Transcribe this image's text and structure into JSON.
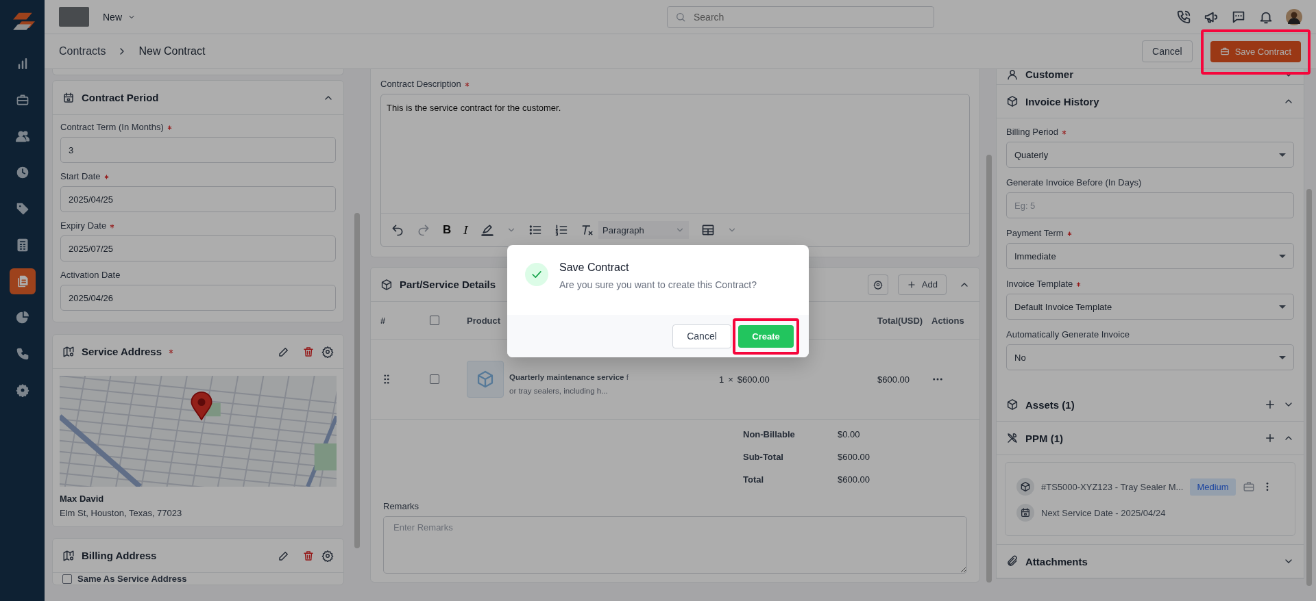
{
  "sidebar": {
    "items": [
      {
        "selected": false
      },
      {
        "selected": false
      },
      {
        "selected": false
      },
      {
        "selected": false
      },
      {
        "selected": false
      },
      {
        "selected": false
      },
      {
        "selected": true
      },
      {
        "selected": false
      },
      {
        "selected": false
      },
      {
        "selected": false
      }
    ]
  },
  "topbar": {
    "workspace_menu": "New",
    "search": {
      "placeholder": "Search"
    }
  },
  "header": {
    "breadcrumb": [
      "Contracts",
      "New Contract"
    ],
    "cancel_button": "Cancel",
    "save_button": {
      "label": "Save Contract",
      "highlighted": true
    }
  },
  "contract_period": {
    "title": "Contract Period",
    "expanded": true,
    "fields": [
      {
        "label": "Contract Term (In Months)",
        "required": true,
        "value": "3"
      },
      {
        "label": "Start Date",
        "required": true,
        "value": "2025/04/25"
      },
      {
        "label": "Expiry Date",
        "required": true,
        "value": "2025/07/25"
      },
      {
        "label": "Activation Date",
        "required": false,
        "value": "2025/04/26"
      }
    ]
  },
  "service_address": {
    "title": "Service Address",
    "required": true,
    "contact_name": "Max David",
    "address": "Elm St, Houston, Texas, 77023"
  },
  "billing_address": {
    "title": "Billing Address",
    "same_as_service": {
      "label": "Same As Service Address",
      "checked": false
    }
  },
  "description": {
    "label": "Contract Description",
    "required": true,
    "value": "This is the service contract for the customer.",
    "bold_glyph": "B",
    "italic_glyph": "I",
    "block_format": "Paragraph"
  },
  "parts": {
    "title": "Part/Service Details",
    "add_label": "Add",
    "expanded": true,
    "columns": [
      "#",
      "Product",
      "Total(USD)",
      "Actions"
    ],
    "select_all": false,
    "rows": [
      {
        "checked": false,
        "description": "**Quarterly maintenance service** for tray sealers, including h...",
        "quantity": "1",
        "multiply_sign": "×",
        "price": "$600.00",
        "total": "$600.00"
      }
    ],
    "summary": [
      {
        "label": "Non-Billable",
        "value": "$0.00"
      },
      {
        "label": "Sub-Total",
        "value": "$600.00"
      },
      {
        "label": "Total",
        "value": "$600.00"
      }
    ],
    "remarks": {
      "label": "Remarks",
      "placeholder": "Enter Remarks"
    }
  },
  "customer": {
    "title": "Customer",
    "expanded": false
  },
  "invoice_history": {
    "title": "Invoice History",
    "expanded": true,
    "fields": [
      {
        "kind": "select",
        "label": "Billing Period",
        "required": true,
        "value": "Quaterly"
      },
      {
        "kind": "input",
        "label": "Generate Invoice Before (In Days)",
        "required": false,
        "placeholder": "Eg: 5"
      },
      {
        "kind": "select",
        "label": "Payment Term",
        "required": true,
        "value": "Immediate"
      },
      {
        "kind": "select",
        "label": "Invoice Template",
        "required": true,
        "value": "Default Invoice Template"
      },
      {
        "kind": "select",
        "label": "Automatically Generate Invoice",
        "required": false,
        "value": "No"
      }
    ]
  },
  "assets": {
    "title": "Assets (1)",
    "expanded": false
  },
  "ppm": {
    "title": "PPM (1)",
    "expanded": true,
    "items": [
      {
        "asset": "#TS5000-XYZ123 - Tray Sealer M...",
        "priority": "Medium",
        "next_service": "Next Service Date - 2025/04/24"
      }
    ]
  },
  "attachments": {
    "title": "Attachments",
    "expanded": false
  },
  "modal": {
    "title": "Save Contract",
    "message": "Are you sure you want to create this Contract?",
    "cancel": "Cancel",
    "confirm": {
      "label": "Create",
      "highlighted": true
    }
  }
}
